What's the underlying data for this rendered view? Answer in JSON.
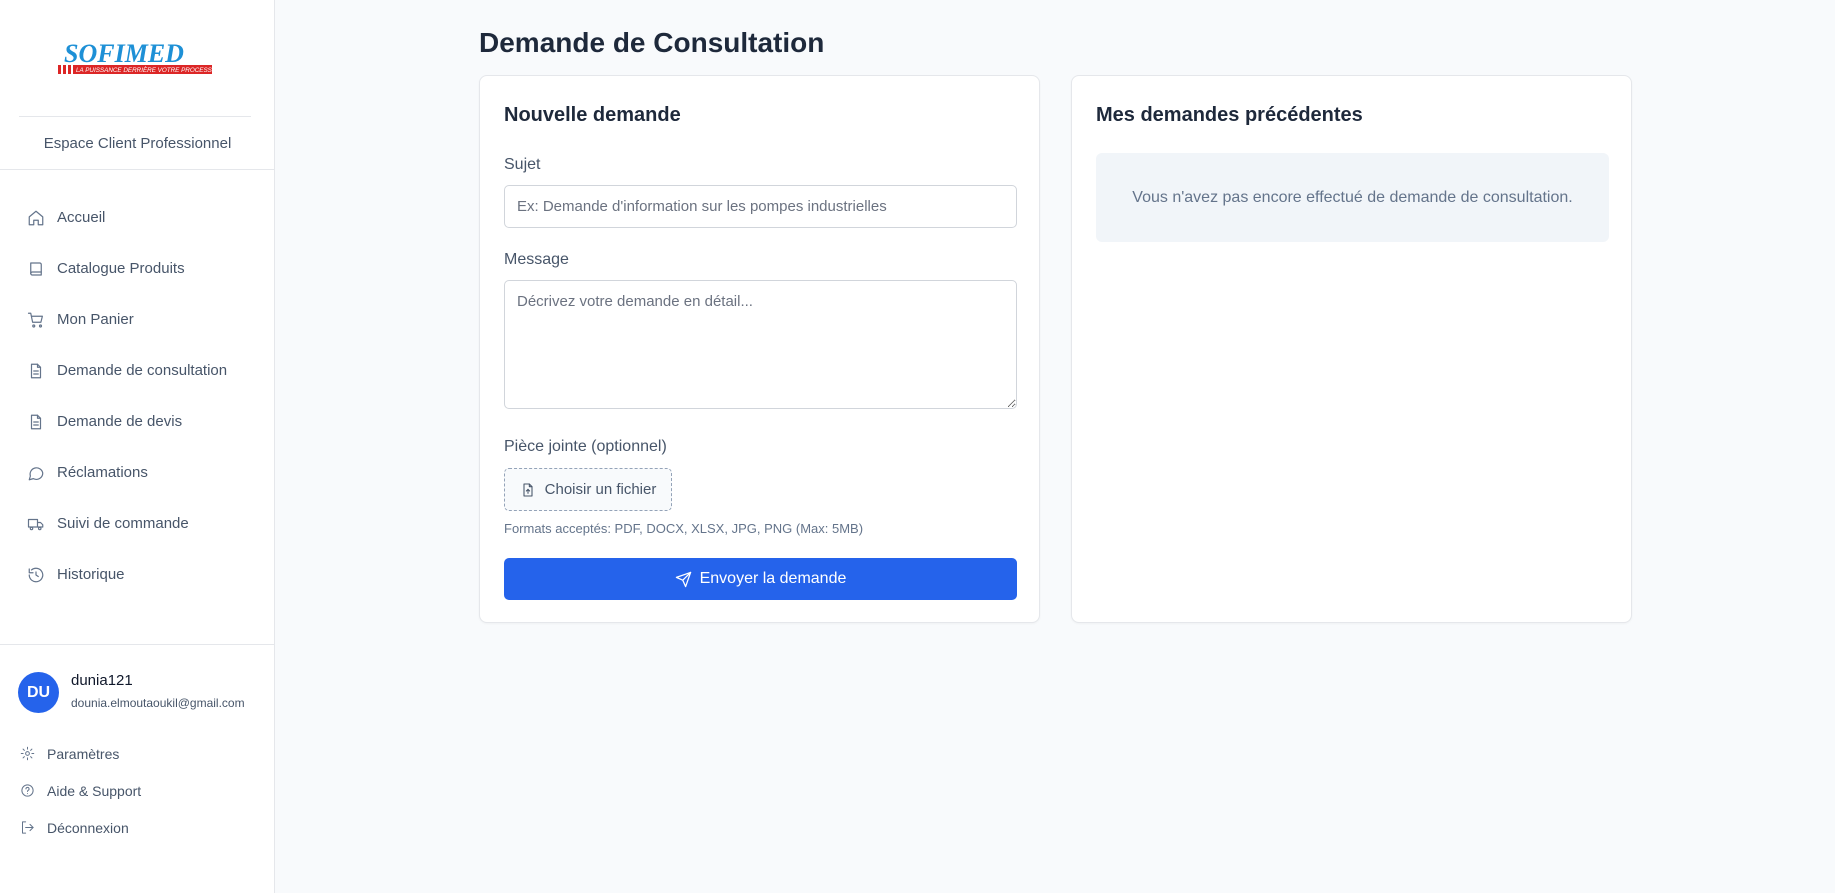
{
  "brand": {
    "logo_text": "SOFIMED",
    "logo_tagline": "LA PUISSANCE DERRIÈRE VOTRE PROCESS",
    "subtitle": "Espace Client Professionnel",
    "colors": {
      "logo_blue": "#1e90d6",
      "logo_red": "#dc2626"
    }
  },
  "nav": {
    "items": [
      {
        "label": "Accueil",
        "icon": "home-icon"
      },
      {
        "label": "Catalogue Produits",
        "icon": "book-icon"
      },
      {
        "label": "Mon Panier",
        "icon": "cart-icon"
      },
      {
        "label": "Demande de consultation",
        "icon": "document-icon"
      },
      {
        "label": "Demande de devis",
        "icon": "document-icon"
      },
      {
        "label": "Réclamations",
        "icon": "chat-icon"
      },
      {
        "label": "Suivi de commande",
        "icon": "truck-icon"
      },
      {
        "label": "Historique",
        "icon": "history-icon"
      }
    ]
  },
  "user": {
    "initials": "DU",
    "name": "dunia121",
    "email": "dounia.elmoutaoukil@gmail.com"
  },
  "bottom_links": [
    {
      "label": "Paramètres",
      "icon": "gear-icon"
    },
    {
      "label": "Aide & Support",
      "icon": "help-icon"
    },
    {
      "label": "Déconnexion",
      "icon": "logout-icon"
    }
  ],
  "page": {
    "title": "Demande de Consultation"
  },
  "form": {
    "title": "Nouvelle demande",
    "subject_label": "Sujet",
    "subject_placeholder": "Ex: Demande d'information sur les pompes industrielles",
    "message_label": "Message",
    "message_placeholder": "Décrivez votre demande en détail...",
    "attachment_label": "Pièce jointe (optionnel)",
    "file_button": "Choisir un fichier",
    "formats_hint": "Formats acceptés: PDF, DOCX, XLSX, JPG, PNG (Max: 5MB)",
    "submit_label": "Envoyer la demande",
    "accent_color": "#2563eb"
  },
  "history": {
    "title": "Mes demandes précédentes",
    "empty_message": "Vous n'avez pas encore effectué de demande de consultation."
  }
}
